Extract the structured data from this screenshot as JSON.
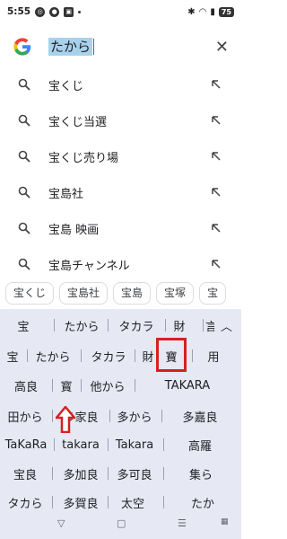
{
  "status_bar": {
    "time": "5:55",
    "battery": "75"
  },
  "search": {
    "query": "たから"
  },
  "suggestions": [
    {
      "text": "宝くじ"
    },
    {
      "text": "宝くじ当選"
    },
    {
      "text": "宝くじ売り場"
    },
    {
      "text": "宝島社"
    },
    {
      "text": "宝島 映画"
    },
    {
      "text": "宝島チャンネル"
    }
  ],
  "chips": [
    "宝くじ",
    "宝島社",
    "宝島",
    "宝塚",
    "宝"
  ],
  "keyboard": {
    "rows": [
      [
        "宝",
        "たから",
        "タカラ",
        "財",
        "言"
      ],
      [
        "宝",
        "たから",
        "タカラ",
        "財",
        "寶",
        "用"
      ],
      [
        "高良",
        "寳",
        "他から",
        "TAKARA"
      ],
      [
        "田から",
        "多家良",
        "多から",
        "多嘉良"
      ],
      [
        "TaKaRa",
        "takara",
        "Takara",
        "高羅"
      ],
      [
        "宝良",
        "多加良",
        "多可良",
        "集ら"
      ],
      [
        "タカら",
        "多賀良",
        "太空",
        "たか"
      ]
    ]
  },
  "annotation_colors": {
    "highlight": "#d62020"
  }
}
